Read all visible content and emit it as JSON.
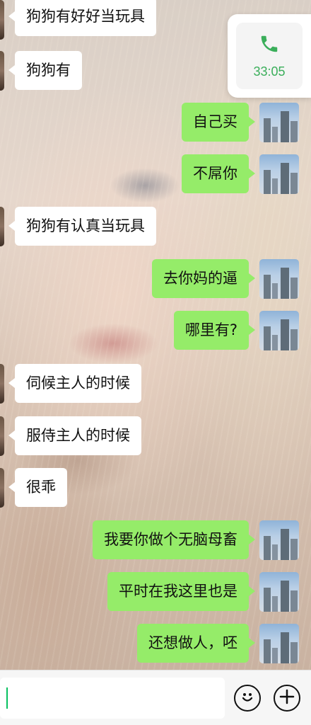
{
  "call_card": {
    "icon": "phone-icon",
    "duration": "33:05",
    "accent": "#3aae5a"
  },
  "messages": [
    {
      "side": "left",
      "text": "狗狗有好好当玩具"
    },
    {
      "side": "left",
      "text": "狗狗有"
    },
    {
      "side": "right",
      "text": "自己买"
    },
    {
      "side": "right",
      "text": "不屌你"
    },
    {
      "side": "left",
      "text": "狗狗有认真当玩具"
    },
    {
      "side": "right",
      "text": "去你妈的逼"
    },
    {
      "side": "right",
      "text": "哪里有?"
    },
    {
      "side": "left",
      "text": "伺候主人的时候"
    },
    {
      "side": "left",
      "text": "服侍主人的时候"
    },
    {
      "side": "left",
      "text": "很乖"
    },
    {
      "side": "right",
      "text": "我要你做个无脑母畜"
    },
    {
      "side": "right",
      "text": "平时在我这里也是"
    },
    {
      "side": "right",
      "text": "还想做人，呸"
    }
  ],
  "colors": {
    "sent_bubble": "#95ec69",
    "received_bubble": "#ffffff",
    "caret": "#07c160"
  },
  "input_bar": {
    "value": "",
    "emoji_icon": "emoji-icon",
    "add_icon": "plus-icon"
  }
}
